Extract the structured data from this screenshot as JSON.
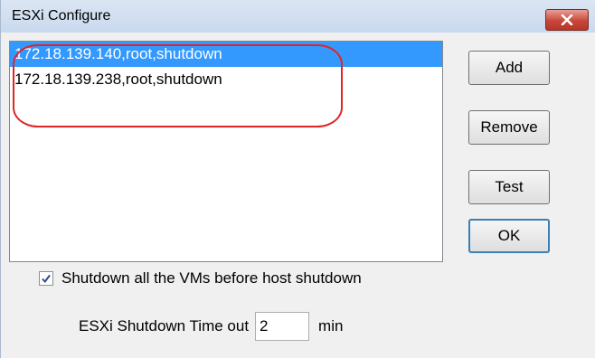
{
  "window": {
    "title": "ESXi Configure"
  },
  "list": {
    "items": [
      {
        "label": "172.18.139.140,root,shutdown",
        "selected": true
      },
      {
        "label": "172.18.139.238,root,shutdown",
        "selected": false
      }
    ]
  },
  "buttons": {
    "add": "Add",
    "remove": "Remove",
    "test": "Test",
    "ok": "OK"
  },
  "options": {
    "shutdown_vms_label": "Shutdown all the VMs before host shutdown",
    "shutdown_vms_checked": true,
    "timeout_label": "ESXi Shutdown Time out",
    "timeout_value": "2",
    "timeout_unit": "min"
  },
  "colors": {
    "selection": "#3399ff",
    "annotation": "#e02525",
    "close_button": "#c8473a"
  }
}
